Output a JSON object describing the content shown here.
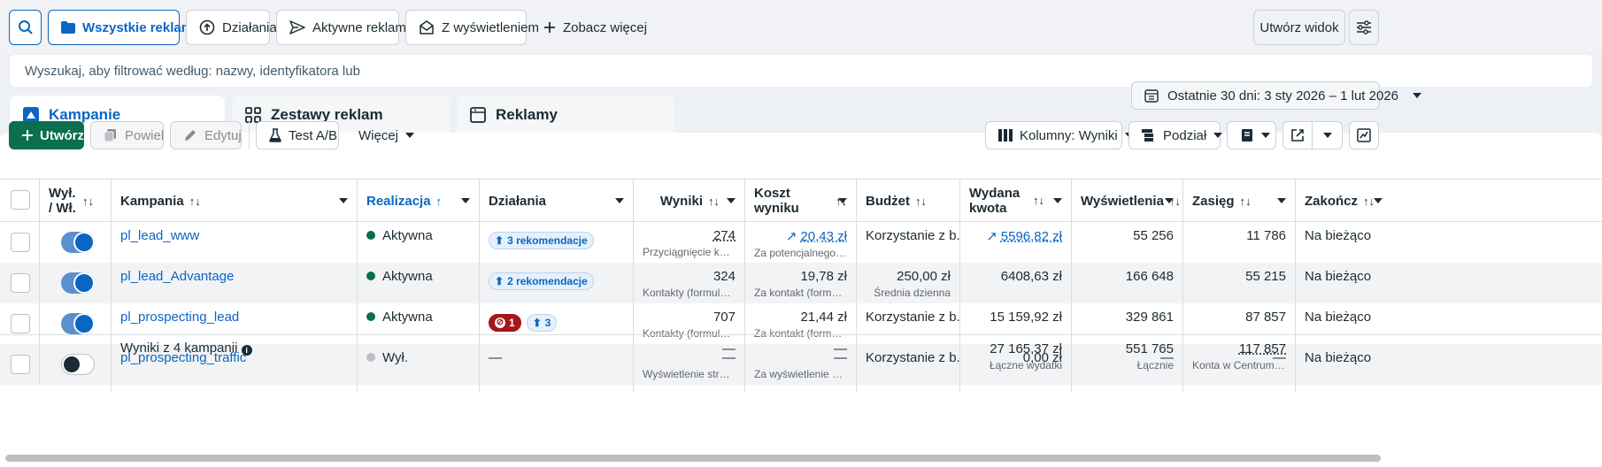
{
  "toolbar": {
    "all_ads": "Wszystkie reklamy",
    "actions": "Działania",
    "active_ads": "Aktywne reklamy",
    "with_impressions": "Z wyświetleniem",
    "see_more": "Zobacz więcej",
    "create_view": "Utwórz widok"
  },
  "search": {
    "placeholder": "Wyszukaj, aby filtrować według: nazwy, identyfikatora lub"
  },
  "tabs": [
    {
      "label": "Kampanie"
    },
    {
      "label": "Zestawy reklam"
    },
    {
      "label": "Reklamy"
    }
  ],
  "date_range": "Ostatnie 30 dni: 3 sty 2026 – 1 lut 2026",
  "actions_bar": {
    "create": "Utwórz",
    "duplicate": "Powiel",
    "edit": "Edytuj",
    "ab_test": "Test A/B",
    "more": "Więcej",
    "columns": "Kolumny: Wyniki",
    "breakdown": "Podział"
  },
  "columns": {
    "onoff": "Wył. / Wł.",
    "campaign": "Kampania",
    "delivery": "Realizacja",
    "actions": "Działania",
    "results": "Wyniki",
    "cost": "Koszt wyniku",
    "budget": "Budżet",
    "spent_1": "Wydana",
    "spent_2": "kwota",
    "impressions": "Wyświetlenia",
    "reach": "Zasięg",
    "ends": "Zakończ"
  },
  "rows": [
    {
      "name": "pl_lead_www",
      "status": "Aktywna",
      "status_color": "#0b6e4f",
      "on": true,
      "actions": "3 rekomendacje",
      "actions_red": "",
      "results": "274",
      "results_sub": "Przyciągnięcie konta...",
      "cost": "20,43 zł",
      "cost_sub": "Za potencjalnego klie...",
      "budget": "Korzystanie z b...",
      "budget_sub": "",
      "spent": "5596,82 zł",
      "impressions": "55 256",
      "reach": "11 786",
      "ends": "Na bieżąco"
    },
    {
      "name": "pl_lead_Advantage",
      "status": "Aktywna",
      "status_color": "#0b6e4f",
      "on": true,
      "actions": "2 rekomendacje",
      "actions_red": "",
      "results": "324",
      "results_sub": "Kontakty (formularz)",
      "cost": "19,78 zł",
      "cost_sub": "Za kontakt (formularz)",
      "budget": "250,00 zł",
      "budget_sub": "Średnia dzienna",
      "spent": "6408,63 zł",
      "impressions": "166 648",
      "reach": "55 215",
      "ends": "Na bieżąco"
    },
    {
      "name": "pl_prospecting_lead",
      "status": "Aktywna",
      "status_color": "#0b6e4f",
      "on": true,
      "actions": "3",
      "actions_red": "1",
      "results": "707",
      "results_sub": "Kontakty (formularz)",
      "cost": "21,44 zł",
      "cost_sub": "Za kontakt (formularz)",
      "budget": "Korzystanie z b...",
      "budget_sub": "",
      "spent": "15 159,92 zł",
      "impressions": "329 861",
      "reach": "87 857",
      "ends": "Na bieżąco"
    },
    {
      "name": "pl_prospecting_traffic",
      "status": "Wył.",
      "status_color": "#bcc0c4",
      "on": false,
      "actions": "—",
      "actions_red": "",
      "results": "—",
      "results_sub": "Wyświetlenie strony ...",
      "cost": "—",
      "cost_sub": "Za wyświetlenie stron...",
      "budget": "Korzystanie z b...",
      "budget_sub": "",
      "spent": "0,00 zł",
      "impressions": "—",
      "reach": "—",
      "ends": "Na bieżąco"
    }
  ],
  "totals": {
    "label": "Wyniki z 4 kampanii",
    "results": "—",
    "cost": "—",
    "spent": "27 165,37 zł",
    "spent_sub": "Łączne wydatki",
    "impressions": "551 765",
    "impressions_sub": "Łącznie",
    "reach": "117 857",
    "reach_sub": "Konta w Centrum kont"
  },
  "colors": {
    "accent": "#0a66c2",
    "create_green": "#0b6e4f",
    "red_badge": "#a4161a"
  },
  "icons": [
    "search-icon",
    "folder-icon",
    "actions-icon",
    "send-icon",
    "envelope-icon",
    "plus-icon",
    "sliders-icon",
    "calendar-icon",
    "flask-icon",
    "columns-icon",
    "breakdown-icon",
    "reports-icon",
    "export-icon",
    "chart-icon"
  ]
}
